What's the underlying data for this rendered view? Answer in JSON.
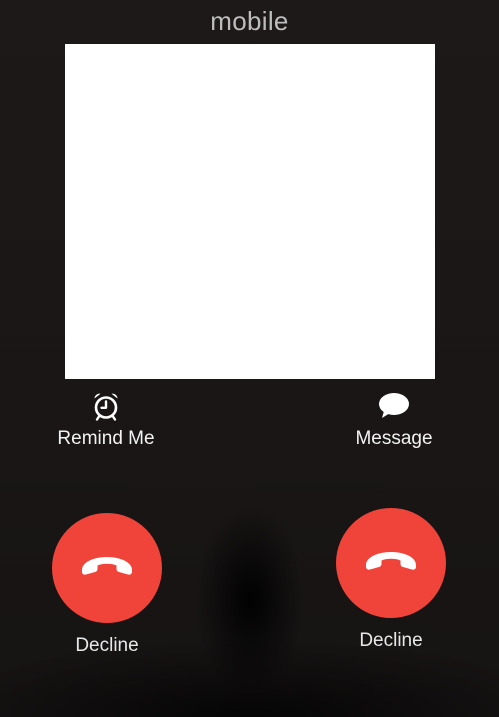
{
  "header": {
    "caller_label": "mobile"
  },
  "actions": {
    "remind_me": {
      "label": "Remind Me",
      "icon": "alarm-clock-icon"
    },
    "message": {
      "label": "Message",
      "icon": "speech-bubble-icon"
    }
  },
  "buttons": {
    "decline_left": {
      "label": "Decline",
      "icon": "phone-hangup-icon"
    },
    "decline_right": {
      "label": "Decline",
      "icon": "phone-hangup-icon"
    }
  },
  "colors": {
    "background": "#1b1818",
    "decline_red": "#f0443a",
    "photo_placeholder": "#ffffff"
  }
}
